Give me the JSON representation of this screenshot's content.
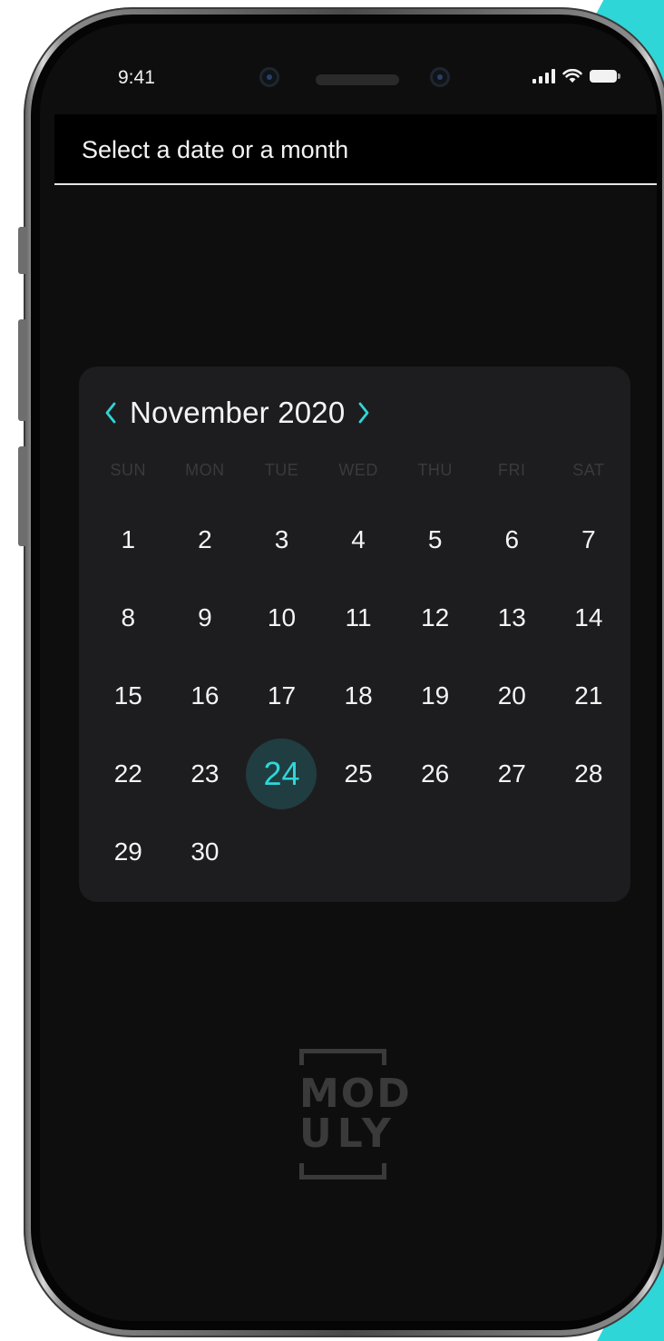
{
  "status_bar": {
    "time": "9:41",
    "icons": [
      "signal-icon",
      "wifi-icon",
      "battery-icon"
    ]
  },
  "header": {
    "title": "Select a date or a month"
  },
  "calendar": {
    "month_label": "November 2020",
    "prev_icon": "chevron-left-icon",
    "next_icon": "chevron-right-icon",
    "weekdays": [
      "SUN",
      "MON",
      "TUE",
      "WED",
      "THU",
      "FRI",
      "SAT"
    ],
    "days": [
      "1",
      "2",
      "3",
      "4",
      "5",
      "6",
      "7",
      "8",
      "9",
      "10",
      "11",
      "12",
      "13",
      "14",
      "15",
      "16",
      "17",
      "18",
      "19",
      "20",
      "21",
      "22",
      "23",
      "24",
      "25",
      "26",
      "27",
      "28",
      "29",
      "30"
    ],
    "selected_day": "24"
  },
  "logo": {
    "line1": "MOD",
    "line2": "ULY"
  },
  "colors": {
    "accent": "#2fd6d8",
    "selected_bg": "#203d41",
    "screen_bg": "#0e0e0e",
    "card_bg": "#1d1d1f",
    "weekday_text": "#3a3a3c"
  }
}
